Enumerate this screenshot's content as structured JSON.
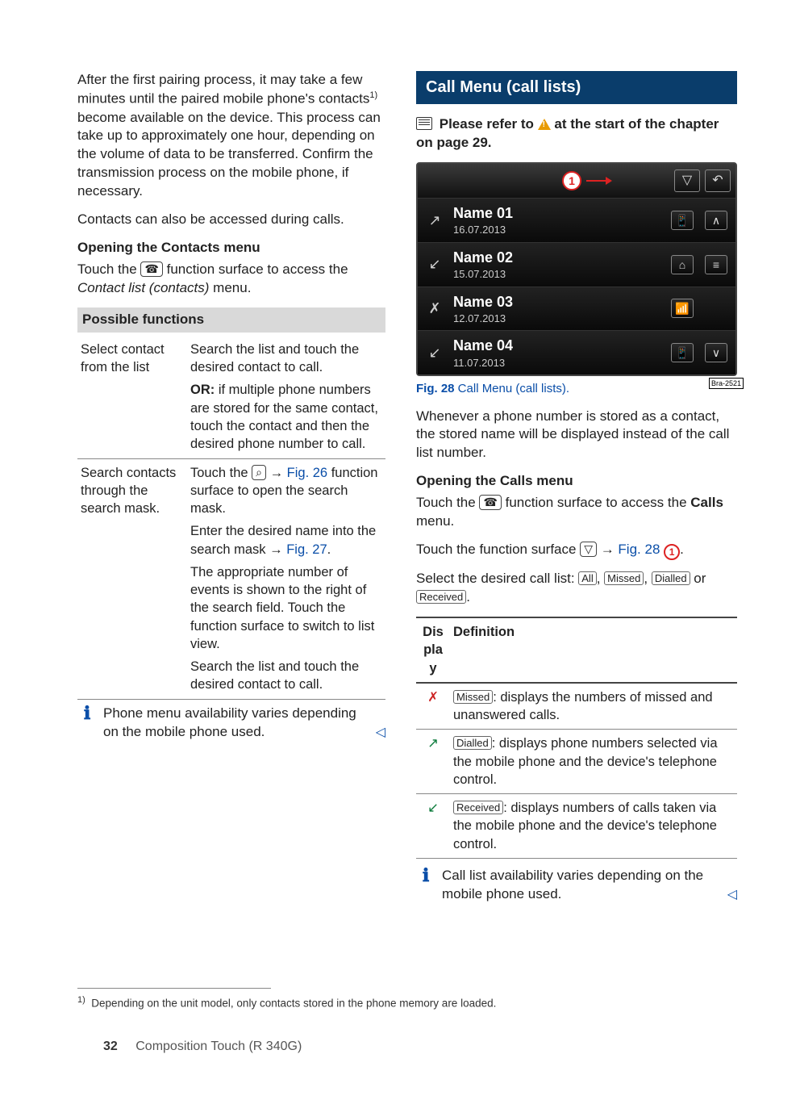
{
  "left": {
    "intro": "After the first pairing process, it may take a few minutes until the paired mobile phone's contacts",
    "intro_sup": "1)",
    "intro2": " become available on the device. This process can take up to approximately one hour, depending on the volume of data to be transferred. Confirm the transmission process on the mobile phone, if necessary.",
    "p2": "Contacts can also be accessed during calls.",
    "h_open_pre": "Opening the ",
    "h_open_mid": "Contacts",
    "h_open_post": " menu",
    "touch_pre": "Touch the ",
    "touch_icon": "☎",
    "touch_post": " function surface to access the ",
    "touch_menu": "Contact list (contacts)",
    "touch_end": " menu.",
    "possible": "Possible functions",
    "row1_l": "Select contact from the list",
    "row1_r1": "Search the list and touch the desired contact to call.",
    "row1_r2_pre": "OR:",
    "row1_r2": " if multiple phone numbers are stored for the same contact, touch the contact and then the desired phone number to call.",
    "row2_l": "Search contacts through the search mask.",
    "row2_r1_pre": "Touch the ",
    "row2_r1_icon": "⌕",
    "row2_r1_mid": " → ",
    "row2_r1_link": "Fig. 26",
    "row2_r1_post": " function surface to open the search mask.",
    "row2_r2_pre": "Enter the desired name into the search mask → ",
    "row2_r2_link": "Fig. 27",
    "row2_r2_post": ".",
    "row2_r3": "The appropriate number of events is shown to the right of the search field. Touch the function surface to switch to list view.",
    "row2_r4": "Search the list and touch the desired contact to call.",
    "note_left": "Phone menu availability varies depending on the mobile phone used."
  },
  "right": {
    "section": "Call Menu (call lists)",
    "please_pre": "Please refer to ",
    "please_post": " at the start of the chapter on page 29.",
    "fig_badge": "1",
    "rows": [
      {
        "icon": "↗",
        "name": "Name 01",
        "date": "16.07.2013",
        "r1": "📱",
        "r2": "∧"
      },
      {
        "icon": "↙",
        "name": "Name 02",
        "date": "15.07.2013",
        "r1": "⌂",
        "r2": "≡"
      },
      {
        "icon": "✗",
        "name": "Name 03",
        "date": "12.07.2013",
        "r1": "📶",
        "r2": ""
      },
      {
        "icon": "↙",
        "name": "Name 04",
        "date": "11.07.2013",
        "r1": "📱",
        "r2": "∨"
      }
    ],
    "hdr_btn1": "▽",
    "hdr_btn2": "↶",
    "bra": "Bra-2521",
    "figcap_b": "Fig. 28",
    "figcap_t": "   Call Menu (call lists).",
    "para1": "Whenever a phone number is stored as a contact, the stored name will be displayed instead of the call list number.",
    "h_open_pre": "Opening the ",
    "h_open_mid": "Calls",
    "h_open_post": " menu",
    "touch_pre": "Touch the ",
    "touch_icon": "☎",
    "touch_post": " function surface to access the ",
    "touch_menu": "Calls",
    "touch_end": " menu.",
    "touch2_pre": "Touch the function surface ",
    "touch2_icon": "▽",
    "touch2_mid": " → ",
    "touch2_link": "Fig. 28",
    "touch2_badge": "1",
    "touch2_post": ".",
    "select_pre": "Select the desired call list: ",
    "sel_all": "All",
    "sel_missed": "Missed",
    "sel_dialled": "Dialled",
    "sel_or": " or ",
    "sel_received": "Received",
    "sel_end": ".",
    "th1": "Display",
    "th2": "Definition",
    "d1_icon": "✗",
    "d1_key": "Missed",
    "d1_t": ": displays the numbers of missed and unanswered calls.",
    "d2_icon": "↗",
    "d2_key": "Dialled",
    "d2_t": ": displays phone numbers selected via the mobile phone and the device's telephone control.",
    "d3_icon": "↙",
    "d3_key": "Received",
    "d3_t": ": displays numbers of calls taken via the mobile phone and the device's telephone control.",
    "note": "Call list availability varies depending on the mobile phone used."
  },
  "foot": {
    "fn_no": "1)",
    "fn": "Depending on the unit model, only contacts stored in the phone memory are loaded.",
    "page": "32",
    "title": "Composition Touch (R 340G)"
  }
}
